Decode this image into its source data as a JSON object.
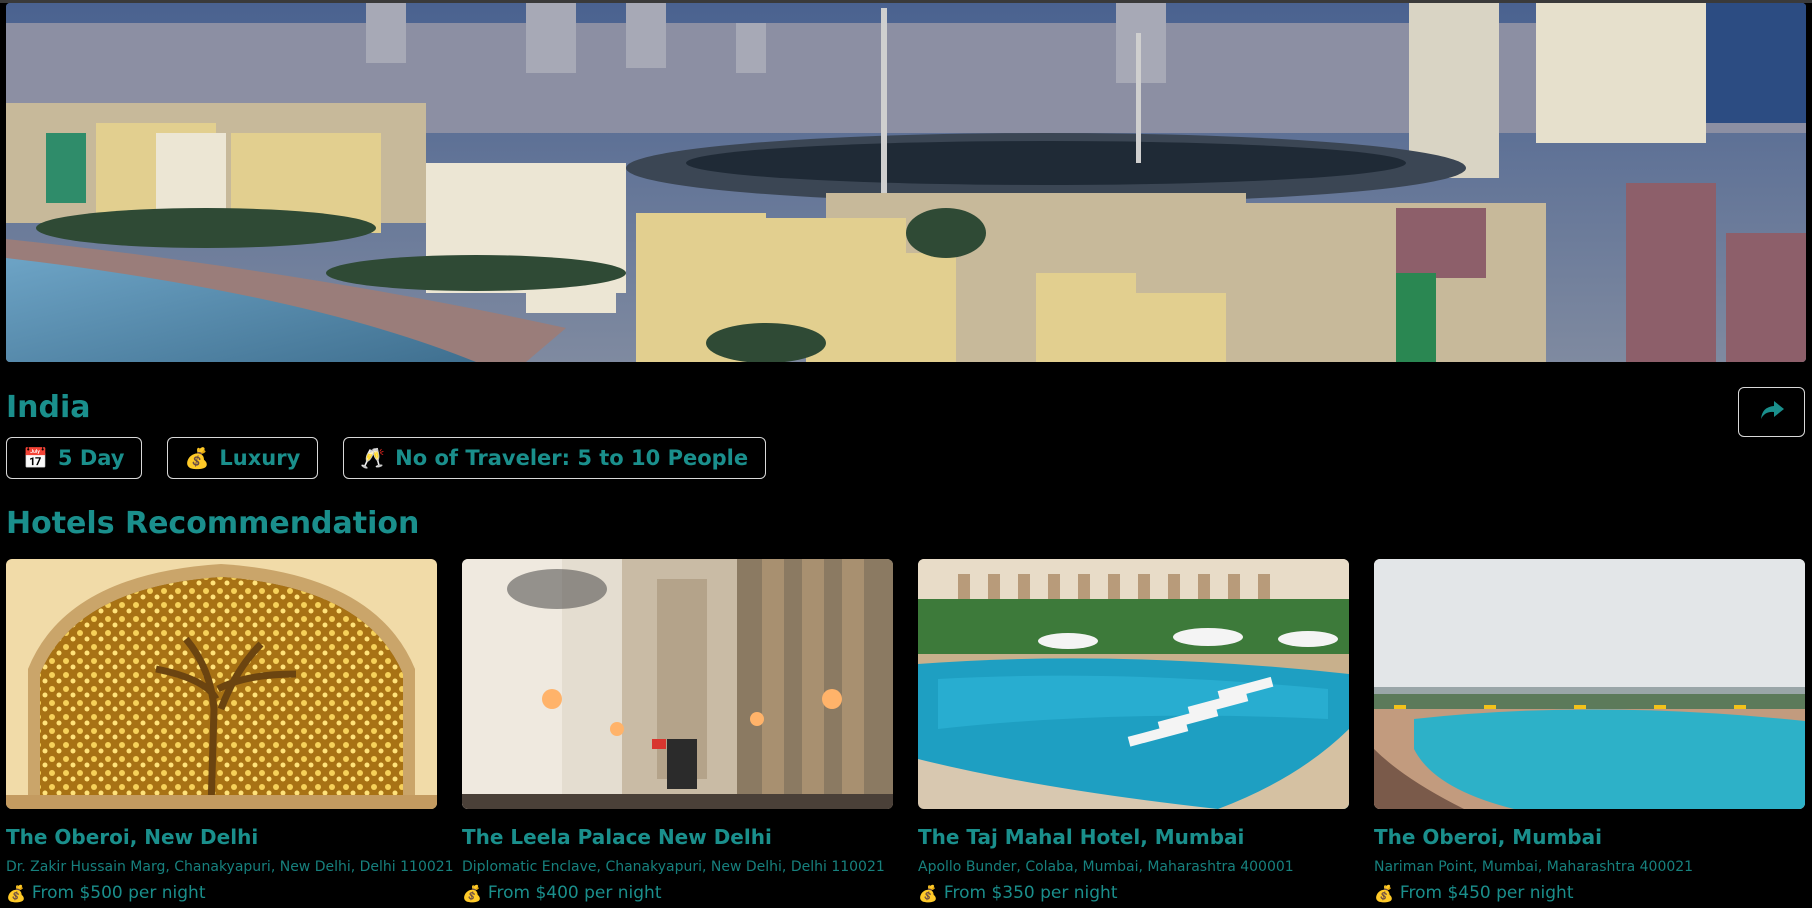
{
  "destination": {
    "title": "India"
  },
  "chips": [
    {
      "icon": "calendar-icon",
      "glyph": "📅",
      "label": "5 Day"
    },
    {
      "icon": "money-bag-icon",
      "glyph": "💰",
      "label": "Luxury"
    },
    {
      "icon": "champagne-icon",
      "glyph": "🥂",
      "label": "No of Traveler: 5 to 10 People"
    }
  ],
  "share": {
    "icon": "share-arrow-icon"
  },
  "section": {
    "hotels_title": "Hotels Recommendation"
  },
  "hotels": [
    {
      "name": "The Oberoi, New Delhi",
      "address": "Dr. Zakir Hussain Marg, Chanakyapuri, New Delhi, Delhi 110021",
      "price_icon": "💰",
      "price": "From $500 per night"
    },
    {
      "name": "The Leela Palace New Delhi",
      "address": "Diplomatic Enclave, Chanakyapuri, New Delhi, Delhi 110021",
      "price_icon": "💰",
      "price": "From $400 per night"
    },
    {
      "name": "The Taj Mahal Hotel, Mumbai",
      "address": "Apollo Bunder, Colaba, Mumbai, Maharashtra 400001",
      "price_icon": "💰",
      "price": "From $350 per night"
    },
    {
      "name": "The Oberoi, Mumbai",
      "address": "Nariman Point, Mumbai, Maharashtra 400021",
      "price_icon": "💰",
      "price": "From $450 per night"
    }
  ],
  "colors": {
    "accent": "#1a8f8c",
    "background": "#000000",
    "border": "#d9d9d9"
  }
}
